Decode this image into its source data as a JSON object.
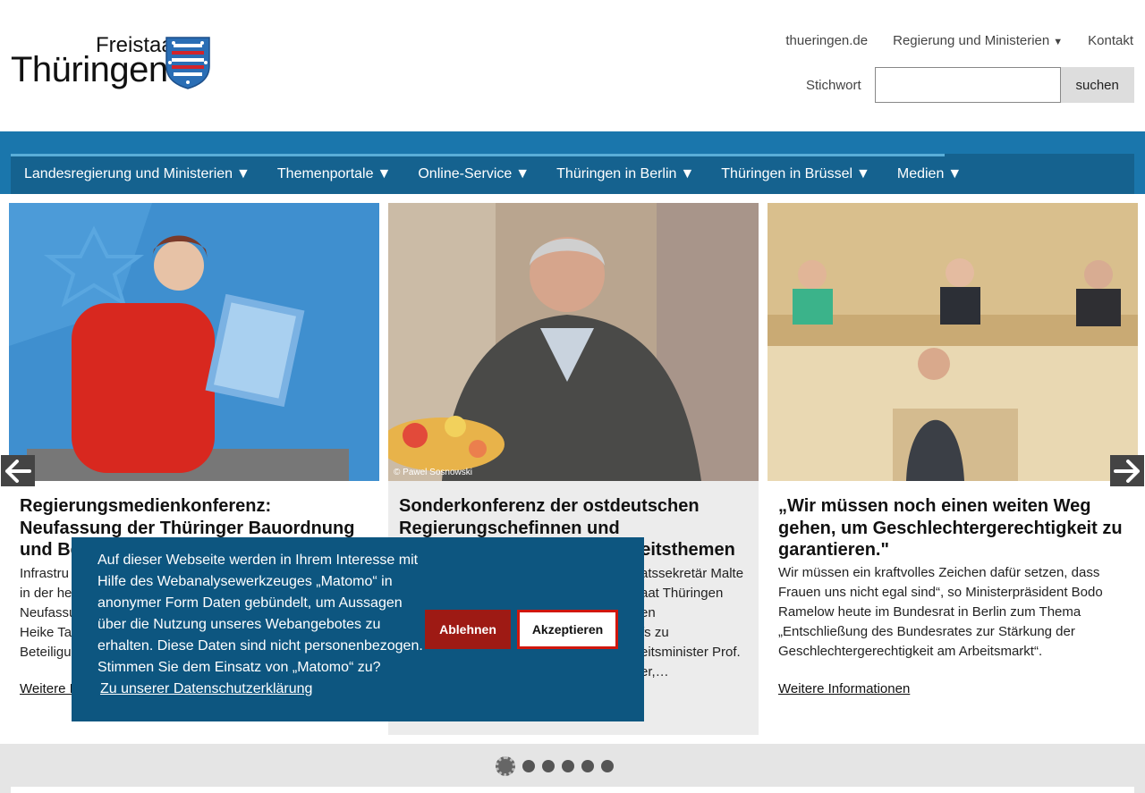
{
  "logo": {
    "line1": "Freistaat",
    "line2": "Thüringen"
  },
  "topnav": {
    "items": [
      "thueringen.de",
      "Regierung und Ministerien",
      "Kontakt"
    ],
    "caret": "▼"
  },
  "search": {
    "label": "Stichwort",
    "value": "",
    "placeholder": "",
    "button": "suchen"
  },
  "mainnav": {
    "items": [
      "Landesregierung und Ministerien",
      "Themenportale",
      "Online-Service",
      "Thüringen in Berlin",
      "Thüringen in Brüssel",
      "Medien"
    ]
  },
  "slides": [
    {
      "title": "Regierungsmedienkonferenz: Neufassung der Thüringer Bauordnung und Be",
      "text": "Infrastru\nin der he\nNeufassu\nHeike Ta\nBeteiligu",
      "more": "Weitere I"
    },
    {
      "photo_credit": "© Pawel Sosnowski",
      "title": "Sonderkonferenz der ostdeutschen Regierungschefinnen und",
      "title_tail": "heitsthemen",
      "text": "atssekretär Malte\naat Thüringen\nen\nfs zu\neitsminister Prof.\ner,…"
    },
    {
      "title": "„Wir müssen noch einen weiten Weg gehen, um Geschlechtergerechtigkeit zu garantieren.\"",
      "text": "Wir müssen ein kraftvolles Zeichen dafür setzen, dass Frauen uns nicht egal sind“, so Ministerpräsident Bodo Ramelow heute im Bundesrat in Berlin zum Thema „Entschließung des Bundesrates zur Stärkung der Geschlechtergerechtigkeit am Arbeitsmarkt“.",
      "more": "Weitere Informationen"
    }
  ],
  "carousel": {
    "active_dot": 1,
    "dot_count": 6
  },
  "cookie": {
    "message": "Auf dieser Webseite werden in Ihrem Interesse mit Hilfe des Webanalysewerkzeuges „Matomo“ in anonymer Form Daten gebündelt, um Aussagen über die Nutzung unseres Webangebotes zu erhalten. Diese Daten sind nicht personenbezogen. Stimmen Sie dem Einsatz von „Matomo“ zu?",
    "link": "Zu unserer Datenschutzerklärung",
    "deny": "Ablehnen",
    "accept": "Akzeptieren"
  },
  "colors": {
    "nav_band": "#1a76ac",
    "nav_bar": "#15628f",
    "cookie_bg": "#0d5680",
    "deny_bg": "#9e1a14",
    "accept_border": "#d0160d"
  }
}
